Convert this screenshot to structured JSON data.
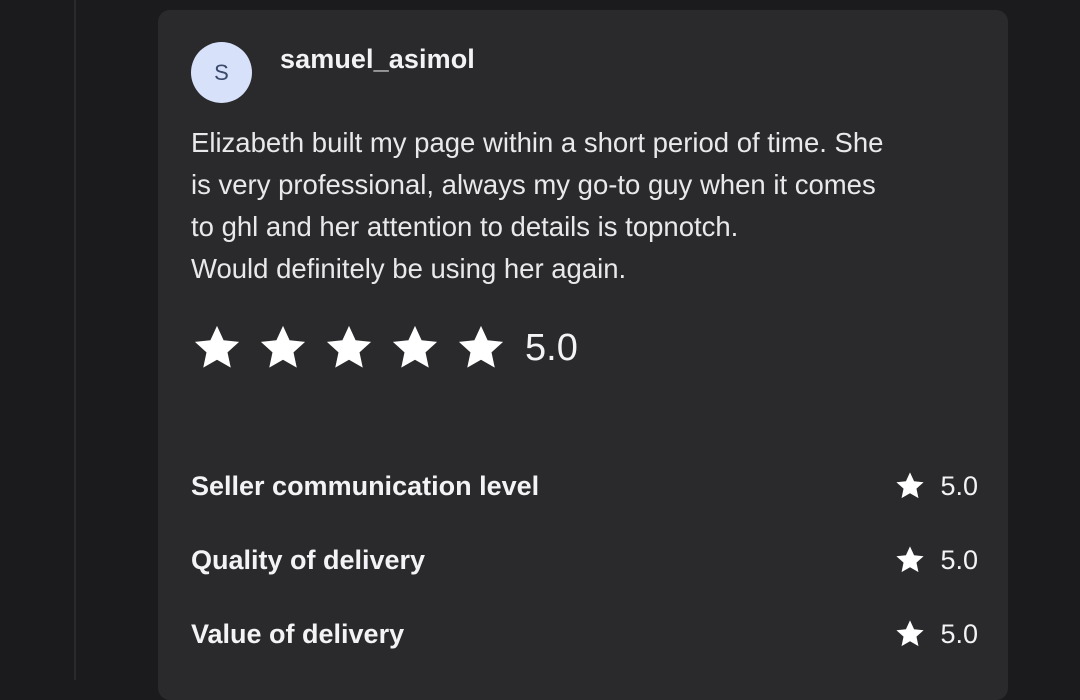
{
  "review": {
    "avatar_initial": "S",
    "username": "samuel_asimol",
    "text_lines": [
      "Elizabeth built my page within a short period of time. She",
      "is very professional, always my go-to guy when it comes",
      "to ghl and her attention to details is topnotch.",
      "Would definitely be using her again."
    ],
    "rating": {
      "stars": 5,
      "max_stars": 5,
      "score": "5.0",
      "star_color": "#ffffff"
    },
    "sub_ratings": [
      {
        "label": "Seller communication level",
        "score": "5.0",
        "icon": "star-icon"
      },
      {
        "label": "Quality of delivery",
        "score": "5.0",
        "icon": "star-icon"
      },
      {
        "label": "Value of delivery",
        "score": "5.0",
        "icon": "star-icon"
      }
    ]
  },
  "colors": {
    "page_background": "#1b1b1d",
    "card_background": "#2a2a2d",
    "avatar_background": "#d7e1fa",
    "text": "#ececee"
  }
}
